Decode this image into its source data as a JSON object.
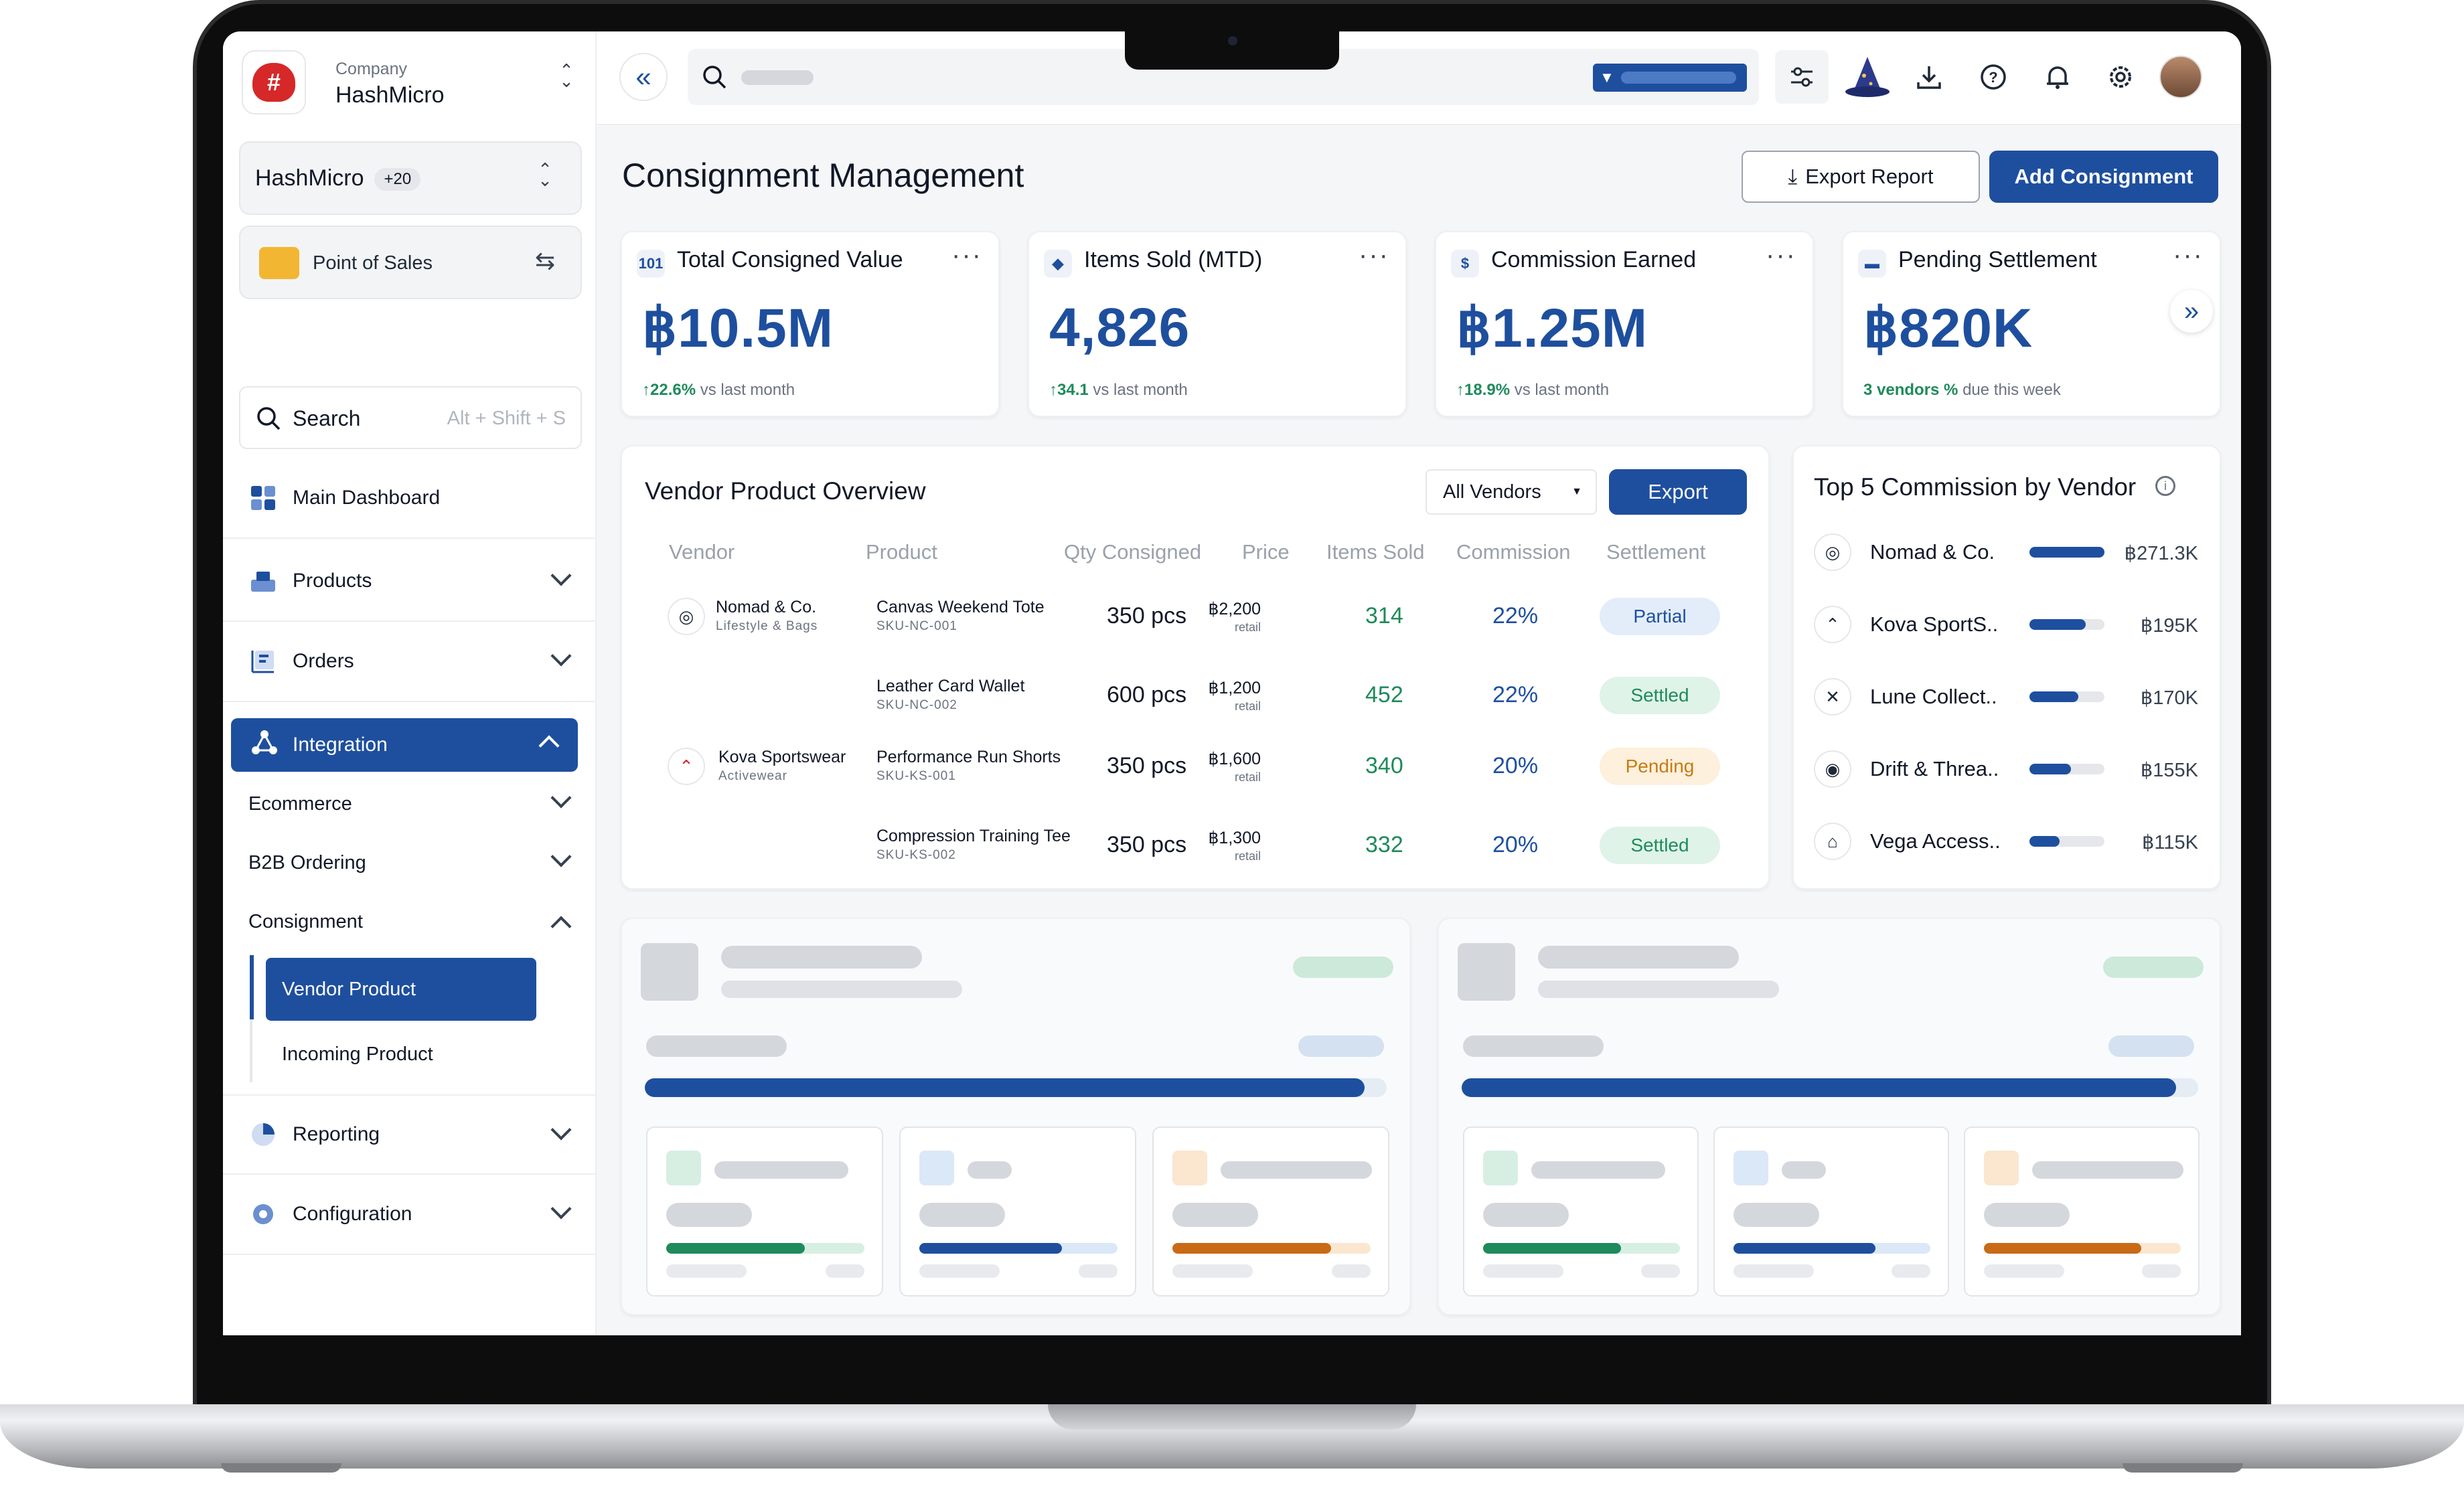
{
  "company": {
    "label": "Company",
    "name": "HashMicro"
  },
  "workspace": {
    "name": "HashMicro",
    "badge": "+20"
  },
  "module": {
    "name": "Point of Sales"
  },
  "search": {
    "label": "Search",
    "shortcut": "Alt + Shift + S"
  },
  "nav": {
    "main_dashboard": "Main Dashboard",
    "products": "Products",
    "orders": "Orders",
    "integration": "Integration",
    "ecommerce": "Ecommerce",
    "b2b": "B2B Ordering",
    "consignment": "Consignment",
    "vendor_product": "Vendor Product",
    "incoming_product": "Incoming Product",
    "reporting": "Reporting",
    "configuration": "Configuration"
  },
  "page": {
    "title": "Consignment Management",
    "export_report": "Export Report",
    "add_consignment": "Add Consignment"
  },
  "kpis": [
    {
      "title": "Total Consigned Value",
      "value": "฿10.5M",
      "change": "↑22.6%",
      "note": "vs last month",
      "icon": "chart-icon"
    },
    {
      "title": "Items Sold (MTD)",
      "value": "4,826",
      "change": "↑34.1",
      "note": "vs last month",
      "icon": "box-icon"
    },
    {
      "title": "Commission Earned",
      "value": "฿1.25M",
      "change": "↑18.9%",
      "note": "vs last month",
      "icon": "dollar-icon"
    },
    {
      "title": "Pending Settlement",
      "value": "฿820K",
      "change": "3 vendors %",
      "note": "due this week",
      "icon": "card-icon"
    }
  ],
  "overview": {
    "title": "Vendor Product Overview",
    "filter": "All Vendors",
    "export": "Export",
    "columns": [
      "Vendor",
      "Product",
      "Qty Consigned",
      "Price",
      "Items Sold",
      "Commission",
      "Settlement"
    ],
    "rows": [
      {
        "vendor": "Nomad & Co.",
        "vendor_cat": "Lifestyle & Bags",
        "product": "Canvas Weekend Tote",
        "sku": "SKU-NC-001",
        "qty": "350 pcs",
        "price": "฿2,200",
        "price_note": "retail",
        "sold": "314",
        "commission": "22%",
        "settlement": "Partial"
      },
      {
        "vendor": "",
        "vendor_cat": "",
        "product": "Leather Card Wallet",
        "sku": "SKU-NC-002",
        "qty": "600 pcs",
        "price": "฿1,200",
        "price_note": "retail",
        "sold": "452",
        "commission": "22%",
        "settlement": "Settled"
      },
      {
        "vendor": "Kova Sportswear",
        "vendor_cat": "Activewear",
        "product": "Performance Run Shorts",
        "sku": "SKU-KS-001",
        "qty": "350 pcs",
        "price": "฿1,600",
        "price_note": "retail",
        "sold": "340",
        "commission": "20%",
        "settlement": "Pending"
      },
      {
        "vendor": "",
        "vendor_cat": "",
        "product": "Compression Training Tee",
        "sku": "SKU-KS-002",
        "qty": "350 pcs",
        "price": "฿1,300",
        "price_note": "retail",
        "sold": "332",
        "commission": "20%",
        "settlement": "Settled"
      }
    ]
  },
  "top5": {
    "title": "Top 5 Commission by Vendor",
    "vendors": [
      {
        "name": "Nomad & Co.",
        "value": "฿271.3K",
        "share": 1.0
      },
      {
        "name": "Kova SportS..",
        "value": "฿195K",
        "share": 0.75
      },
      {
        "name": "Lune Collect..",
        "value": "฿170K",
        "share": 0.65
      },
      {
        "name": "Drift & Threa..",
        "value": "฿155K",
        "share": 0.55
      },
      {
        "name": "Vega Access..",
        "value": "฿115K",
        "share": 0.4
      }
    ]
  },
  "colors": {
    "primary": "#1e4f9e",
    "green": "#1f8a5b",
    "partial_bg": "#e3edf9",
    "settled_bg": "#dff3e8",
    "pending_bg": "#fdf0dc"
  }
}
